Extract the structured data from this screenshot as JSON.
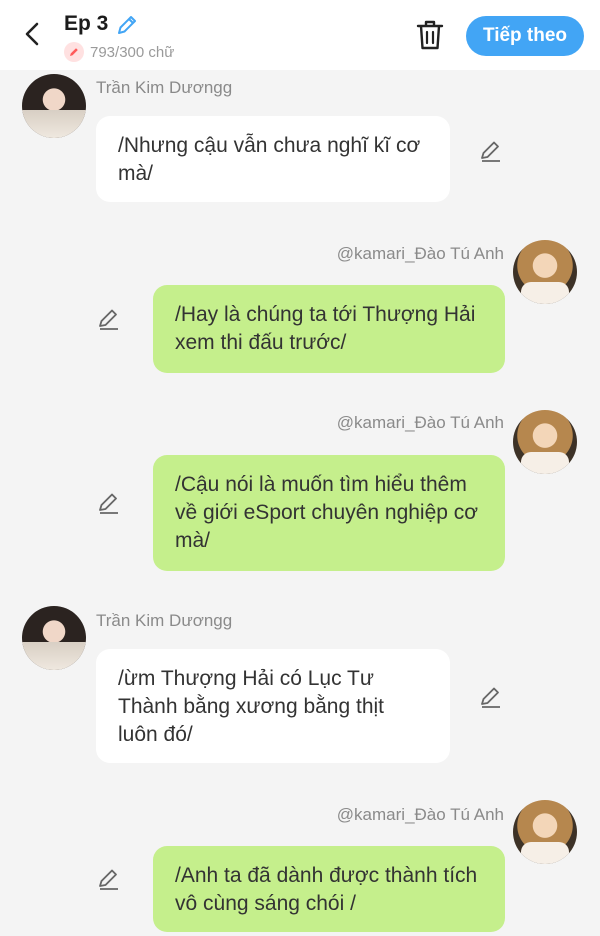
{
  "header": {
    "title": "Ep 3",
    "count": "793/300 chữ",
    "next_label": "Tiếp theo"
  },
  "messages": [
    {
      "speaker": "Trần Kim Dươngg",
      "side": "left",
      "text": "/Nhưng cậu vẫn chưa nghĩ kĩ cơ mà/"
    },
    {
      "speaker": "@kamari_Đào Tú Anh",
      "side": "right",
      "text": "/Hay là chúng ta tới Thượng Hải xem thi đấu trước/"
    },
    {
      "speaker": "@kamari_Đào Tú Anh",
      "side": "right",
      "text": "/Cậu nói là muốn tìm hiểu thêm về giới eSport chuyên nghiệp cơ mà/"
    },
    {
      "speaker": "Trần Kim Dươngg",
      "side": "left",
      "text": "/ừm Thượng Hải có Lục Tư Thành bằng xương bằng thịt luôn đó/"
    },
    {
      "speaker": "@kamari_Đào Tú Anh",
      "side": "right",
      "text": "/Anh ta đã dành được thành tích vô cùng sáng chói /"
    }
  ],
  "colors": {
    "accent": "#42a5f5",
    "right_bubble": "#c5ef8c",
    "left_bubble": "#ffffff",
    "background": "#f4f4f4"
  }
}
